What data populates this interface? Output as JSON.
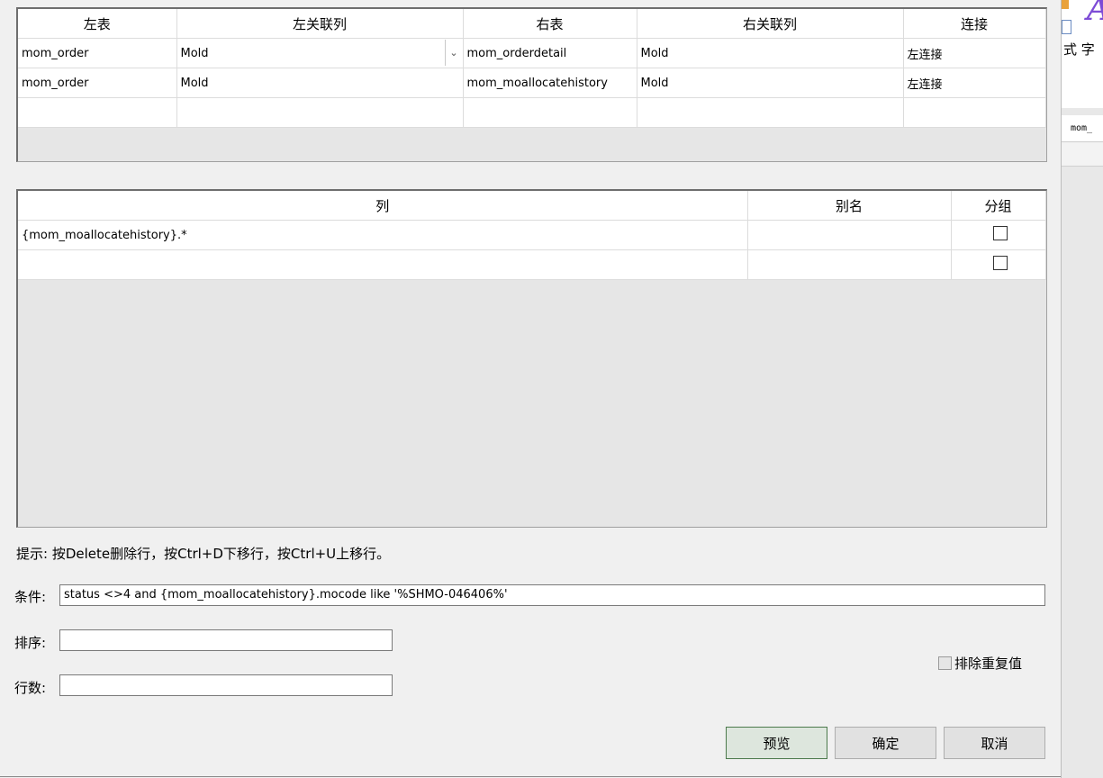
{
  "join_grid": {
    "headers": [
      "左表",
      "左关联列",
      "右表",
      "右关联列",
      "连接"
    ],
    "rows": [
      [
        "mom_order",
        "Mold",
        "mom_orderdetail",
        "Mold",
        "左连接"
      ],
      [
        "mom_order",
        "Mold",
        "mom_moallocatehistory",
        "Mold",
        "左连接"
      ],
      [
        "",
        "",
        "",
        "",
        ""
      ]
    ]
  },
  "column_grid": {
    "headers": [
      "列",
      "别名",
      "分组"
    ],
    "rows": [
      {
        "column": "{mom_moallocatehistory}.*",
        "alias": "",
        "group": false
      },
      {
        "column": "",
        "alias": "",
        "group": false
      }
    ]
  },
  "hint": "提示: 按Delete删除行，按Ctrl+D下移行，按Ctrl+U上移行。",
  "condition": {
    "label": "条件:",
    "value": "status <>4 and {mom_moallocatehistory}.mocode like '%SHMO-046406%'"
  },
  "sort": {
    "label": "排序:",
    "value": ""
  },
  "rows": {
    "label": "行数:",
    "value": ""
  },
  "distinct": {
    "label": "排除重复值",
    "checked": false
  },
  "buttons": {
    "preview": "预览",
    "ok": "确定",
    "cancel": "取消"
  },
  "background_window": {
    "partial_text": "式 字",
    "tab_label": "mom_"
  }
}
